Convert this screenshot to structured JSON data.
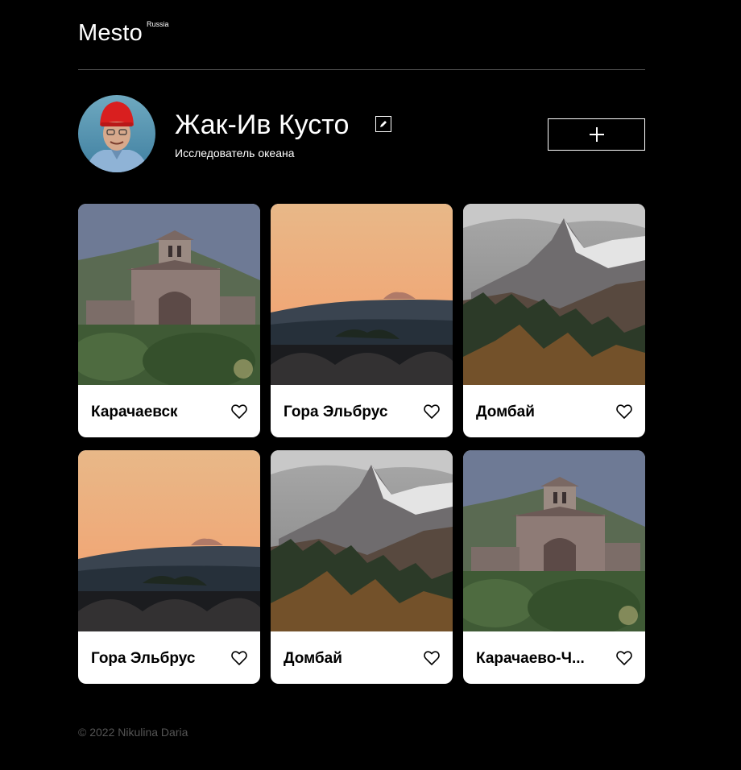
{
  "header": {
    "logo": "Mesto",
    "logo_sup": "Russia"
  },
  "profile": {
    "name": "Жак-Ив Кусто",
    "about": "Исследователь океана",
    "edit_icon": "edit-icon",
    "add_icon": "plus-icon"
  },
  "cards": [
    {
      "title": "Карачаевск",
      "scene": "church"
    },
    {
      "title": "Гора Эльбрус",
      "scene": "elbrus"
    },
    {
      "title": "Домбай",
      "scene": "dombai"
    },
    {
      "title": "Гора Эльбрус",
      "scene": "elbrus"
    },
    {
      "title": "Домбай",
      "scene": "dombai"
    },
    {
      "title": "Карачаево-Ч...",
      "scene": "church"
    }
  ],
  "footer": {
    "copyright": "© 2022 Nikulina Daria"
  },
  "colors": {
    "background": "#000000",
    "card": "#ffffff",
    "footer_text": "#545454",
    "divider": "#545454"
  }
}
